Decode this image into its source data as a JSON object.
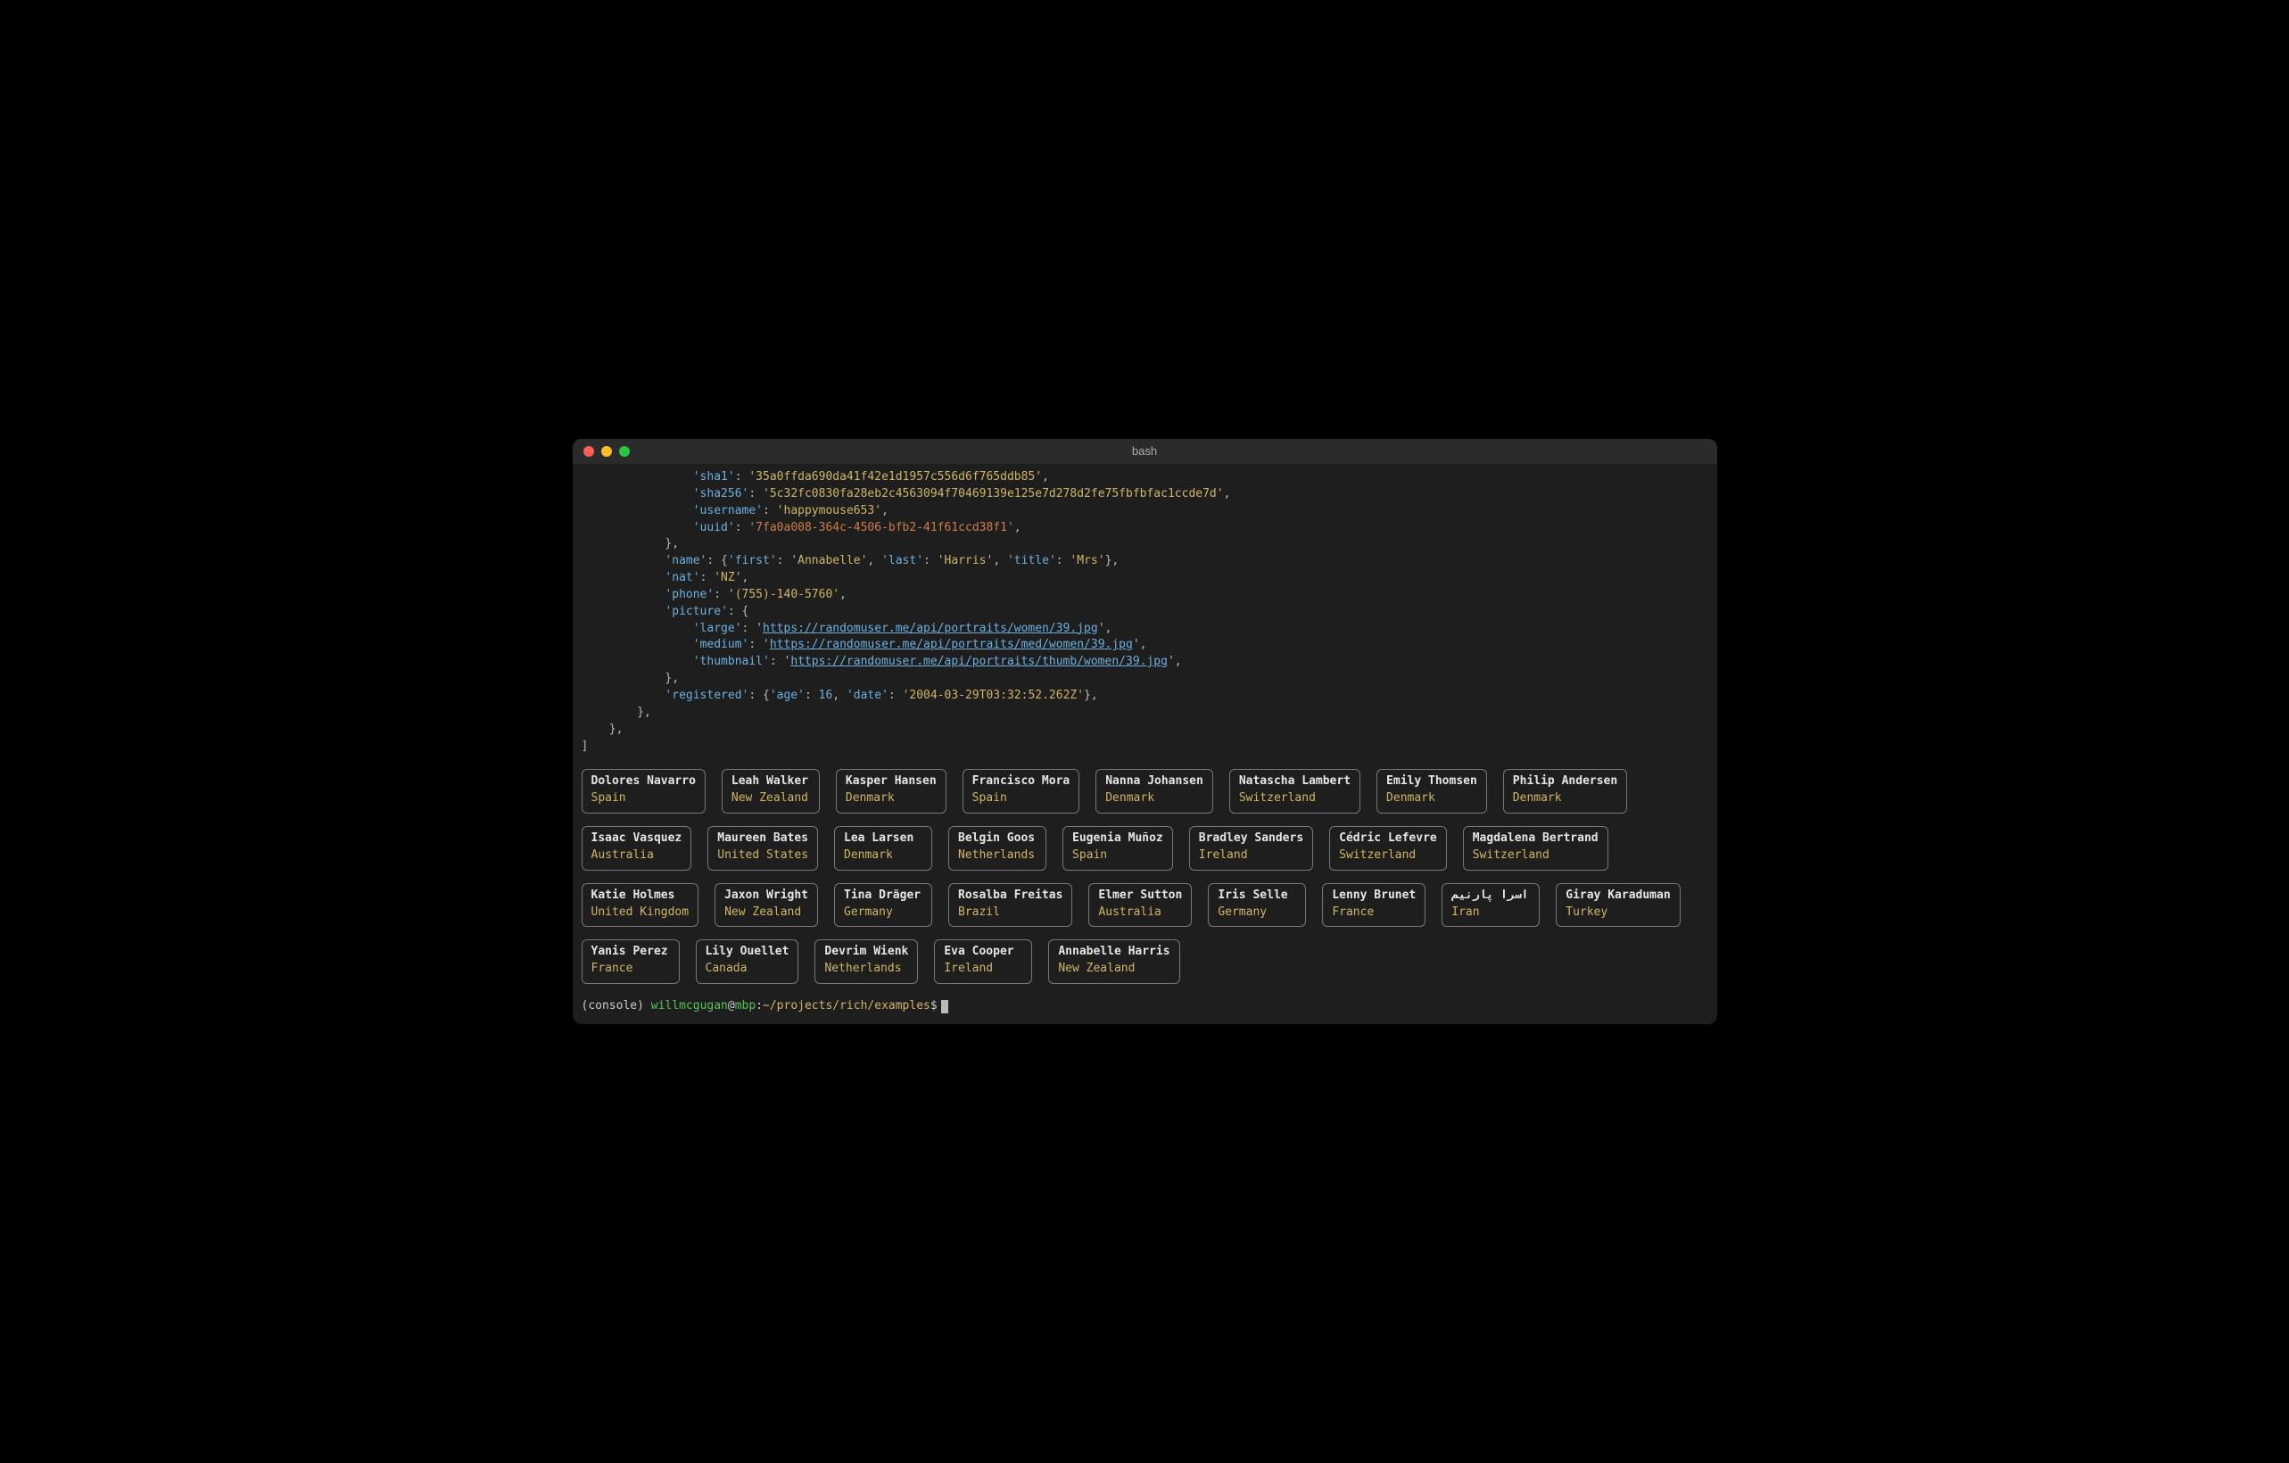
{
  "window": {
    "title": "bash"
  },
  "code": {
    "indent3": "            ",
    "indent4": "                ",
    "sha1_key": "'sha1'",
    "sha1_val": "'35a0ffda690da41f42e1d1957c556d6f765ddb85'",
    "sha256_key": "'sha256'",
    "sha256_val": "'5c32fc0830fa28eb2c4563094f70469139e125e7d278d2fe75fbfbfac1ccde7d'",
    "username_key": "'username'",
    "username_val": "'happymouse653'",
    "uuid_key": "'uuid'",
    "uuid_val": "'7fa0a008-364c-4506-bfb2-41f61ccd38f1'",
    "close_brace_comma": "},",
    "name_key": "'name'",
    "name_obj_open": "{",
    "first_key": "'first'",
    "first_val": "'Annabelle'",
    "last_key": "'last'",
    "last_val": "'Harris'",
    "title_key": "'title'",
    "title_val": "'Mrs'",
    "name_obj_close": "},",
    "nat_key": "'nat'",
    "nat_val": "'NZ'",
    "phone_key": "'phone'",
    "phone_val": "'(755)-140-5760'",
    "picture_key": "'picture'",
    "picture_open": "{",
    "large_key": "'large'",
    "large_url": "https://randomuser.me/api/portraits/women/39.jpg",
    "medium_key": "'medium'",
    "medium_url": "https://randomuser.me/api/portraits/med/women/39.jpg",
    "thumb_key": "'thumbnail'",
    "thumb_url": "https://randomuser.me/api/portraits/thumb/women/39.jpg",
    "registered_key": "'registered'",
    "age_key": "'age'",
    "age_val": "16",
    "date_key": "'date'",
    "date_val": "'2004-03-29T03:32:52.262Z'",
    "registered_close": "},",
    "outer_close1": "    },",
    "outer_close2": "]",
    "colon_sp": ": ",
    "comma_sp": ", ",
    "comma": ",",
    "sq": "'",
    "name_indent": "        ",
    "mid_close_indent": "            "
  },
  "cards": [
    {
      "name": "Dolores Navarro",
      "country": "Spain"
    },
    {
      "name": "Leah Walker",
      "country": "New Zealand"
    },
    {
      "name": "Kasper Hansen",
      "country": "Denmark"
    },
    {
      "name": "Francisco Mora",
      "country": "Spain"
    },
    {
      "name": "Nanna Johansen",
      "country": "Denmark"
    },
    {
      "name": "Natascha Lambert",
      "country": "Switzerland"
    },
    {
      "name": "Emily Thomsen",
      "country": "Denmark"
    },
    {
      "name": "Philip Andersen",
      "country": "Denmark"
    },
    {
      "name": "Isaac Vasquez",
      "country": "Australia"
    },
    {
      "name": "Maureen Bates",
      "country": "United States"
    },
    {
      "name": "Lea Larsen",
      "country": "Denmark"
    },
    {
      "name": "Belgin Goos",
      "country": "Netherlands"
    },
    {
      "name": "Eugenia Muñoz",
      "country": "Spain"
    },
    {
      "name": "Bradley Sanders",
      "country": "Ireland"
    },
    {
      "name": "Cédric Lefevre",
      "country": "Switzerland"
    },
    {
      "name": "Magdalena Bertrand",
      "country": "Switzerland"
    },
    {
      "name": "Katie Holmes",
      "country": "United Kingdom"
    },
    {
      "name": "Jaxon Wright",
      "country": "New Zealand"
    },
    {
      "name": "Tina Dräger",
      "country": "Germany"
    },
    {
      "name": "Rosalba Freitas",
      "country": "Brazil"
    },
    {
      "name": "Elmer Sutton",
      "country": "Australia"
    },
    {
      "name": "Iris Selle",
      "country": "Germany"
    },
    {
      "name": "Lenny Brunet",
      "country": "France"
    },
    {
      "name": "اسرا پارنیم",
      "country": "Iran"
    },
    {
      "name": "Giray Karaduman",
      "country": "Turkey"
    },
    {
      "name": "Yanis Perez",
      "country": "France"
    },
    {
      "name": "Lily Ouellet",
      "country": "Canada"
    },
    {
      "name": "Devrim Wienk",
      "country": "Netherlands"
    },
    {
      "name": "Eva Cooper",
      "country": "Ireland"
    },
    {
      "name": "Annabelle Harris",
      "country": "New Zealand"
    }
  ],
  "prompt": {
    "env": "(console) ",
    "user": "willmcgugan",
    "at": "@",
    "host": "mbp",
    "colon": ":",
    "path": "~/projects/rich/examples",
    "dollar": "$"
  }
}
